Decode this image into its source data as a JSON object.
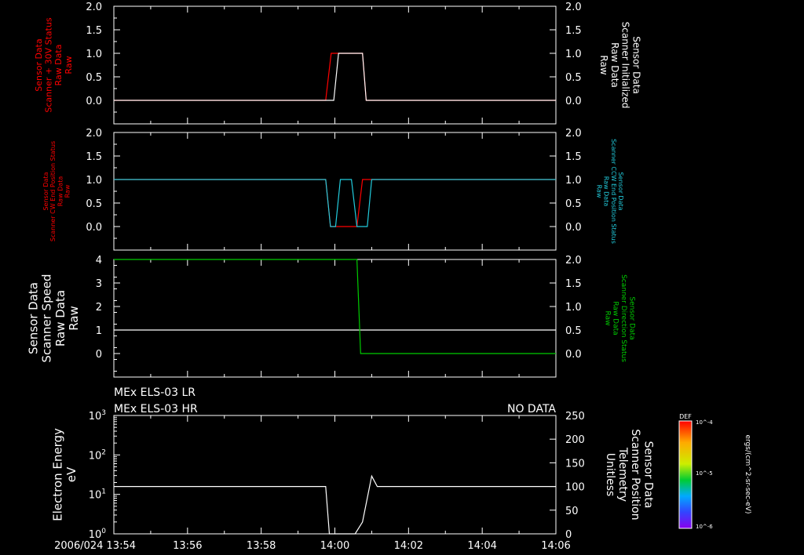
{
  "colors": {
    "background": "#000000",
    "white": "#ffffff",
    "red": "#ff0000",
    "cyan": "#22ccdd",
    "green": "#00cc00"
  },
  "time_axis": {
    "ticks": [
      "13:54",
      "13:56",
      "13:58",
      "14:00",
      "14:02",
      "14:04",
      "14:06"
    ],
    "first_label": "2006/024 13:54"
  },
  "header": {
    "line1": "MEx ELS-03 LR",
    "line2": "MEx ELS-03 HR",
    "status": "NO DATA"
  },
  "colorbar": {
    "label_top": "DEF",
    "ticks": [
      "10^-4",
      "10^-5",
      "10^-6"
    ],
    "units": "ergs/(cm^2-sr-sec-eV)"
  },
  "chart_data": [
    {
      "type": "line",
      "panel": 1,
      "left_label": [
        "Sensor Data",
        "Scanner + 30V Status",
        "Raw Data",
        "Raw"
      ],
      "left_color": "#ff0000",
      "right_label": [
        "Sensor Data",
        "Scanner Initialized",
        "Raw Data",
        "Raw"
      ],
      "right_color": "#ffffff",
      "left_ticks": [
        "2.0",
        "1.5",
        "1.0",
        "0.5",
        "0.0"
      ],
      "right_ticks": [
        "2.0",
        "1.5",
        "1.0",
        "0.5",
        "0.0"
      ],
      "ylim": [
        -0.5,
        2.0
      ],
      "series": [
        {
          "color": "#ff0000",
          "points": [
            [
              0,
              0
            ],
            [
              5.75,
              0
            ],
            [
              5.9,
              1
            ],
            [
              6.75,
              1
            ],
            [
              6.85,
              0
            ],
            [
              12,
              0
            ]
          ]
        },
        {
          "color": "#ffffff",
          "points": [
            [
              0,
              0
            ],
            [
              5.97,
              0
            ],
            [
              6.1,
              1
            ],
            [
              6.75,
              1
            ],
            [
              6.85,
              0
            ],
            [
              12,
              0
            ]
          ]
        }
      ]
    },
    {
      "type": "line",
      "panel": 2,
      "left_label": [
        "Sensor Data",
        "Scanner CW End Position Status",
        "Raw Data",
        "Raw"
      ],
      "left_color": "#ff0000",
      "right_label": [
        "Sensor Data",
        "Scanner CCW End Position Status",
        "Raw Data",
        "Raw"
      ],
      "right_color": "#22ccdd",
      "left_ticks": [
        "2.0",
        "1.5",
        "1.0",
        "0.5",
        "0.0"
      ],
      "right_ticks": [
        "2.0",
        "1.5",
        "1.0",
        "0.5",
        "0.0"
      ],
      "ylim": [
        -0.5,
        2.0
      ],
      "series": [
        {
          "color": "#ff0000",
          "points": [
            [
              0,
              1
            ],
            [
              5.75,
              1
            ],
            [
              5.88,
              0
            ],
            [
              6.6,
              0
            ],
            [
              6.75,
              1
            ],
            [
              12,
              1
            ]
          ]
        },
        {
          "color": "#22ccdd",
          "points": [
            [
              0,
              1
            ],
            [
              5.75,
              1
            ],
            [
              5.88,
              0
            ],
            [
              6.02,
              0
            ],
            [
              6.15,
              1
            ],
            [
              6.45,
              1
            ],
            [
              6.6,
              0
            ],
            [
              6.88,
              0
            ],
            [
              7.0,
              1
            ],
            [
              12,
              1
            ]
          ]
        }
      ]
    },
    {
      "type": "line",
      "panel": 3,
      "left_label": [
        "Sensor Data",
        "Scanner Speed",
        "Raw Data",
        "Raw"
      ],
      "left_color": "#ffffff",
      "right_label": [
        "Sensor Data",
        "Scanner Direction Status",
        "Raw Data",
        "Raw"
      ],
      "right_color": "#00cc00",
      "left_ticks": [
        "4",
        "3",
        "2",
        "1",
        "0"
      ],
      "right_ticks": [
        "2.0",
        "1.5",
        "1.0",
        "0.5",
        "0.0"
      ],
      "ylim": [
        -1,
        4
      ],
      "series": [
        {
          "color": "#ffffff",
          "points": [
            [
              0,
              1
            ],
            [
              12,
              1
            ]
          ]
        },
        {
          "color": "#00cc00",
          "points": [
            [
              0,
              2
            ],
            [
              6.6,
              2
            ],
            [
              6.7,
              0
            ],
            [
              12,
              0
            ]
          ]
        }
      ]
    },
    {
      "type": "line",
      "panel": 4,
      "left_label": [
        "Electron Energy",
        "eV"
      ],
      "left_color": "#ffffff",
      "right_label": [
        "Sensor Data",
        "Scanner Position",
        "Telemetry",
        "Unitless"
      ],
      "right_color": "#ffffff",
      "left_ticks": [
        "10^3",
        "10^2",
        "10^1",
        "10^0"
      ],
      "right_ticks": [
        "250",
        "200",
        "150",
        "100",
        "50",
        "0"
      ],
      "ylim": [
        0,
        250
      ],
      "series": [
        {
          "color": "#ffffff",
          "points": [
            [
              0,
              100
            ],
            [
              5.75,
              100
            ],
            [
              5.85,
              0
            ],
            [
              6.55,
              0
            ],
            [
              6.75,
              25
            ],
            [
              7.0,
              122
            ],
            [
              7.15,
              100
            ],
            [
              12,
              100
            ]
          ]
        }
      ]
    }
  ]
}
